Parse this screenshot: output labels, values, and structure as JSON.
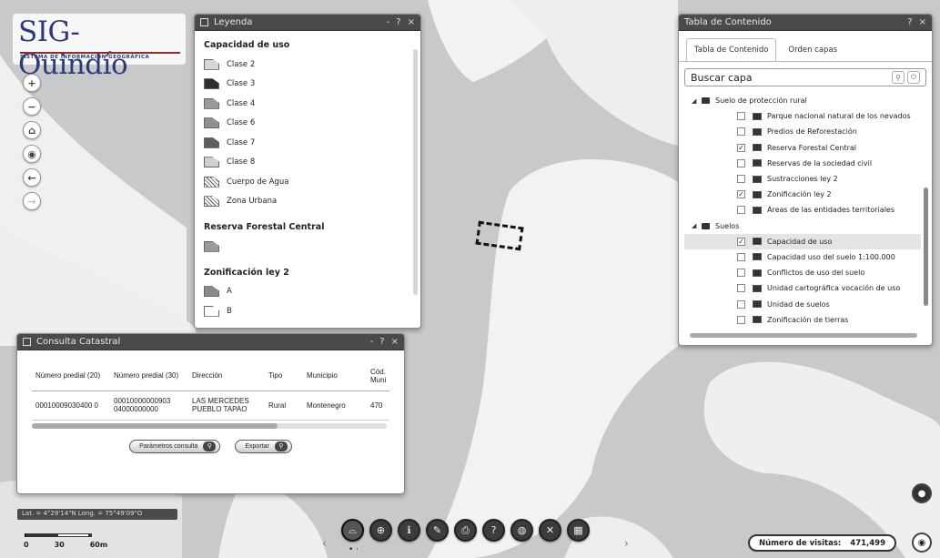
{
  "logo": {
    "title": "SIG-Quindío",
    "subtitle": "SISTEMA DE INFORMACIÓN GEOGRÁFICA"
  },
  "nav": {
    "zoom_in": "+",
    "zoom_out": "−",
    "home": "⌂",
    "locate": "◉",
    "back": "←",
    "forward": "→"
  },
  "legend": {
    "title": "Leyenda",
    "controls": {
      "minimize": "-",
      "help": "?",
      "close": "×"
    },
    "groups": [
      {
        "name": "Capacidad de uso",
        "items": [
          {
            "label": "Clase 2",
            "color": "#d6d6d6",
            "pattern": "solid"
          },
          {
            "label": "Clase 3",
            "color": "#2e2e2e",
            "pattern": "solid"
          },
          {
            "label": "Clase 4",
            "color": "#9a9a9a",
            "pattern": "solid"
          },
          {
            "label": "Clase 6",
            "color": "#8f8f8f",
            "pattern": "solid"
          },
          {
            "label": "Clase 7",
            "color": "#5e5e5e",
            "pattern": "solid"
          },
          {
            "label": "Clase 8",
            "color": "#cfcfcf",
            "pattern": "solid"
          },
          {
            "label": "Cuerpo de Agua",
            "color": "#ffffff",
            "pattern": "hatch"
          },
          {
            "label": "Zona Urbana",
            "color": "#ffffff",
            "pattern": "hatch"
          }
        ]
      },
      {
        "name": "Reserva Forestal Central",
        "items": [
          {
            "label": "",
            "color": "#9a9a9a",
            "pattern": "solid"
          }
        ]
      },
      {
        "name": "Zonificación ley 2",
        "items": [
          {
            "label": "A",
            "color": "#8a8a8a",
            "pattern": "solid"
          },
          {
            "label": "B",
            "color": "#ffffff",
            "pattern": "solid"
          }
        ]
      }
    ]
  },
  "toc": {
    "title": "Tabla de Contenido",
    "controls": {
      "help": "?",
      "close": "×"
    },
    "tabs": [
      {
        "label": "Tabla de Contenido",
        "active": true
      },
      {
        "label": "Orden capas",
        "active": false
      }
    ],
    "search": {
      "value": "Buscar capa",
      "search_icon": "⚲",
      "clear_icon": "⏻"
    },
    "rows": [
      {
        "type": "folder",
        "label": "Suelo de protección rural",
        "checked": false,
        "selected": false
      },
      {
        "type": "layer",
        "label": "Parque nacional natural de los nevados",
        "checked": false,
        "selected": false
      },
      {
        "type": "layer",
        "label": "Predios de Reforestación",
        "checked": false,
        "selected": false
      },
      {
        "type": "layer",
        "label": "Reserva Forestal Central",
        "checked": true,
        "selected": false
      },
      {
        "type": "layer",
        "label": "Reservas de la sociedad civil",
        "checked": false,
        "selected": false
      },
      {
        "type": "layer",
        "label": "Sustracciones ley 2",
        "checked": false,
        "selected": false
      },
      {
        "type": "layer",
        "label": "Zonificación ley 2",
        "checked": true,
        "selected": false
      },
      {
        "type": "layer",
        "label": "Áreas de las entidades territoriales",
        "checked": false,
        "selected": false
      },
      {
        "type": "folder",
        "label": "Suelos",
        "checked": false,
        "selected": false
      },
      {
        "type": "layer",
        "label": "Capacidad de uso",
        "checked": true,
        "selected": true
      },
      {
        "type": "layer",
        "label": "Capacidad uso del suelo 1:100.000",
        "checked": false,
        "selected": false
      },
      {
        "type": "layer",
        "label": "Conflictos de uso del suelo",
        "checked": false,
        "selected": false
      },
      {
        "type": "layer",
        "label": "Unidad cartográfica vocación de uso",
        "checked": false,
        "selected": false
      },
      {
        "type": "layer",
        "label": "Unidad de suelos",
        "checked": false,
        "selected": false
      },
      {
        "type": "layer",
        "label": "Zonificación de tierras",
        "checked": false,
        "selected": false
      }
    ]
  },
  "consulta": {
    "title": "Consulta Catastral",
    "controls": {
      "minimize": "-",
      "help": "?",
      "close": "×"
    },
    "columns": [
      "Número predial (20)",
      "Número predial (30)",
      "Dirección",
      "Tipo",
      "Municipio",
      "Cód. Muni"
    ],
    "rows": [
      [
        "00010009030400 0",
        "00010000000903 04000000000",
        "LAS MERCEDES PUEBLO TAPAO",
        "Rural",
        "Montenegro",
        "470"
      ]
    ],
    "buttons": {
      "params": "Parámetros consulta",
      "export": "Exportar"
    }
  },
  "status": {
    "coords": "Lat. = 4°29'14\"N Long. = 75°49'09\"O",
    "scale_labels": [
      "0",
      "30",
      "60m"
    ],
    "visits_label": "Número de visitas:",
    "visits_value": "471,499"
  },
  "toolbar": {
    "prev": "‹",
    "next": "›",
    "dots": "• ·",
    "tools": [
      {
        "icon": "measure-icon",
        "glyph": "⌓"
      },
      {
        "icon": "zoom-box-icon",
        "glyph": "⊕"
      },
      {
        "icon": "identify-icon",
        "glyph": "ℹ"
      },
      {
        "icon": "draw-icon",
        "glyph": "✎"
      },
      {
        "icon": "print-icon",
        "glyph": "⎙"
      },
      {
        "icon": "query-icon",
        "glyph": "?"
      },
      {
        "icon": "globe-icon",
        "glyph": "◍"
      },
      {
        "icon": "tools-icon",
        "glyph": "✕"
      },
      {
        "icon": "table-icon",
        "glyph": "▦"
      }
    ]
  },
  "colors": {
    "map_light": "#f1f1f1",
    "map_medium": "#c9cacc",
    "panel_title": "#4a4a4a"
  }
}
